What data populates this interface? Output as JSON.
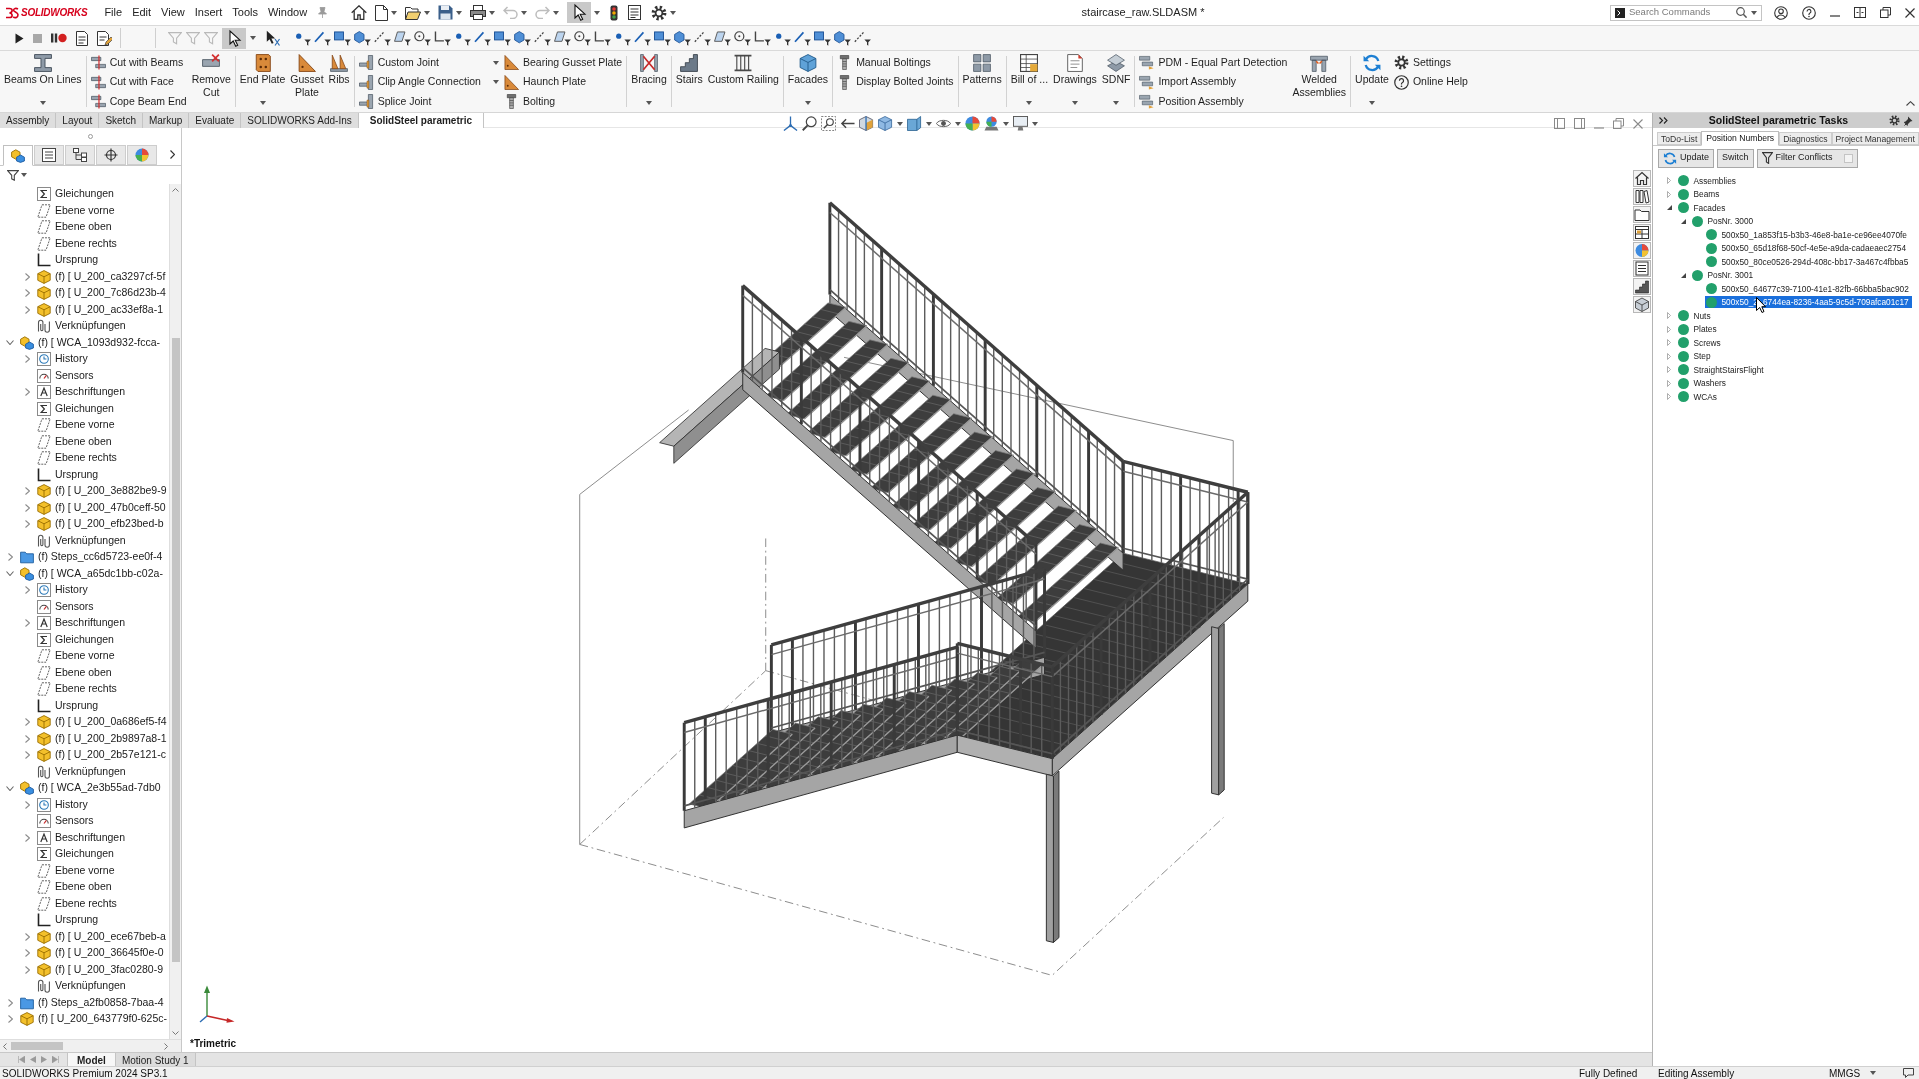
{
  "app_menu": {
    "logo": "SOLIDWORKS",
    "items": [
      "File",
      "Edit",
      "View",
      "Insert",
      "Tools",
      "Window"
    ]
  },
  "quick_access": {
    "undo": {
      "disabled": true
    },
    "redo": {
      "disabled": true
    },
    "select": {
      "on": true
    }
  },
  "window": {
    "title": "staircase_raw.SLDASM *"
  },
  "search": {
    "placeholder": "Search Commands"
  },
  "macro_toolbar": {
    "stop": {
      "disabled": true
    }
  },
  "selection_toolbar": {
    "clear_filters": {
      "disabled": true
    },
    "select": {
      "on": true
    }
  },
  "ribbon": {
    "groups": [
      [
        {
          "kind": "large",
          "label": "Beams On Lines",
          "dropdown": true
        }
      ],
      [
        {
          "kind": "stack",
          "items": [
            {
              "label": "Cut with Beams",
              "dropdown": false
            },
            {
              "label": "Cut with Face",
              "dropdown": false
            },
            {
              "label": "Cope Beam End",
              "dropdown": false
            }
          ]
        },
        {
          "kind": "large",
          "label": "Remove\nCut",
          "dropdown": false
        }
      ],
      [
        {
          "kind": "large",
          "label": "End Plate",
          "dropdown": true
        },
        {
          "kind": "large",
          "label": "Gusset\nPlate",
          "dropdown": false
        },
        {
          "kind": "large",
          "label": "Ribs",
          "dropdown": false
        }
      ],
      [
        {
          "kind": "stack",
          "items": [
            {
              "label": "Custom Joint",
              "dropdown": true
            },
            {
              "label": "Clip Angle Connection",
              "dropdown": true
            },
            {
              "label": "Splice Joint",
              "dropdown": false
            }
          ]
        },
        {
          "kind": "stack",
          "items": [
            {
              "label": "Bearing Gusset Plate",
              "dropdown": false
            },
            {
              "label": "Haunch Plate",
              "dropdown": false
            },
            {
              "label": "Bolting",
              "dropdown": false
            }
          ]
        }
      ],
      [
        {
          "kind": "large",
          "label": "Bracing",
          "dropdown": true
        }
      ],
      [
        {
          "kind": "large",
          "label": "Stairs",
          "dropdown": false
        },
        {
          "kind": "large",
          "label": "Custom Railing",
          "dropdown": false
        }
      ],
      [
        {
          "kind": "large",
          "label": "Facades",
          "dropdown": true
        }
      ],
      [
        {
          "kind": "stack",
          "items": [
            {
              "label": "Manual Boltings",
              "dropdown": false
            },
            {
              "label": "Display Bolted Joints",
              "dropdown": false
            }
          ]
        }
      ],
      [
        {
          "kind": "large",
          "label": "Patterns",
          "dropdown": false
        }
      ],
      [
        {
          "kind": "large",
          "label": "Bill of ...",
          "dropdown": true
        },
        {
          "kind": "large",
          "label": "Drawings",
          "dropdown": true
        },
        {
          "kind": "large",
          "label": "SDNF",
          "dropdown": true
        }
      ],
      [
        {
          "kind": "stack",
          "items": [
            {
              "label": "PDM - Equal Part Detection",
              "dropdown": false
            },
            {
              "label": "Import Assembly",
              "dropdown": false
            },
            {
              "label": "Position Assembly",
              "dropdown": false
            }
          ]
        },
        {
          "kind": "large",
          "label": "Welded\nAssemblies",
          "dropdown": false
        }
      ],
      [
        {
          "kind": "large",
          "label": "Update",
          "dropdown": true
        },
        {
          "kind": "stack",
          "items": [
            {
              "label": "Settings",
              "dropdown": false
            },
            {
              "label": "Online Help",
              "dropdown": false
            }
          ]
        }
      ]
    ]
  },
  "ribbon_tabs": [
    {
      "label": "Assembly",
      "selected": false
    },
    {
      "label": "Layout",
      "selected": false
    },
    {
      "label": "Sketch",
      "selected": false
    },
    {
      "label": "Markup",
      "selected": false
    },
    {
      "label": "Evaluate",
      "selected": false
    },
    {
      "label": "SOLIDWORKS Add-Ins",
      "selected": false
    },
    {
      "label": "SolidSteel parametric",
      "selected": true
    }
  ],
  "feature_panel": {
    "tabs": [
      {
        "selected": true
      },
      {
        "selected": false
      },
      {
        "selected": false
      },
      {
        "selected": false
      },
      {
        "selected": false
      }
    ]
  },
  "feature_tree": {
    "items": [
      {
        "kind": "offscreen",
        "children": [
          {
            "kind": "equations",
            "label": "Gleichungen",
            "selected": false
          },
          {
            "kind": "plane",
            "label": "Ebene vorne",
            "selected": false
          },
          {
            "kind": "plane",
            "label": "Ebene oben",
            "selected": false
          },
          {
            "kind": "plane",
            "label": "Ebene rechts",
            "selected": false
          },
          {
            "kind": "origin",
            "label": "Ursprung",
            "selected": false
          },
          {
            "kind": "part",
            "label": "(f) [ U_200_ca3297cf-5f",
            "expanded": false,
            "selected": false
          },
          {
            "kind": "part",
            "label": "(f) [ U_200_7c86d23b-4",
            "expanded": false,
            "selected": false
          },
          {
            "kind": "part",
            "label": "(f) [ U_200_ac33ef8a-1",
            "expanded": false,
            "selected": false
          },
          {
            "kind": "mates",
            "label": "Verknüpfungen",
            "selected": false
          }
        ]
      },
      {
        "kind": "assembly",
        "label": "(f) [ WCA_1093d932-fcca-",
        "expanded": true,
        "selected": false,
        "children": [
          {
            "kind": "history",
            "label": "History",
            "expanded": false,
            "selected": false
          },
          {
            "kind": "sensors",
            "label": "Sensors",
            "selected": false
          },
          {
            "kind": "annotations",
            "label": "Beschriftungen",
            "expanded": false,
            "selected": false
          },
          {
            "kind": "equations",
            "label": "Gleichungen",
            "selected": false
          },
          {
            "kind": "plane",
            "label": "Ebene vorne",
            "selected": false
          },
          {
            "kind": "plane",
            "label": "Ebene oben",
            "selected": false
          },
          {
            "kind": "plane",
            "label": "Ebene rechts",
            "selected": false
          },
          {
            "kind": "origin",
            "label": "Ursprung",
            "selected": false
          },
          {
            "kind": "part",
            "label": "(f) [ U_200_3e882be9-9",
            "expanded": false,
            "selected": false
          },
          {
            "kind": "part",
            "label": "(f) [ U_200_47b0ceff-50",
            "expanded": false,
            "selected": false
          },
          {
            "kind": "part",
            "label": "(f) [ U_200_efb23bed-b",
            "expanded": false,
            "selected": false
          },
          {
            "kind": "mates",
            "label": "Verknüpfungen",
            "selected": false
          }
        ]
      },
      {
        "kind": "folder",
        "label": "(f) Steps_cc6d5723-ee0f-4",
        "expanded": false,
        "selected": false
      },
      {
        "kind": "assembly",
        "label": "(f) [ WCA_a65dc1bb-c02a-",
        "expanded": true,
        "selected": false,
        "children": [
          {
            "kind": "history",
            "label": "History",
            "expanded": false,
            "selected": false
          },
          {
            "kind": "sensors",
            "label": "Sensors",
            "selected": false
          },
          {
            "kind": "annotations",
            "label": "Beschriftungen",
            "expanded": false,
            "selected": false
          },
          {
            "kind": "equations",
            "label": "Gleichungen",
            "selected": false
          },
          {
            "kind": "plane",
            "label": "Ebene vorne",
            "selected": false
          },
          {
            "kind": "plane",
            "label": "Ebene oben",
            "selected": false
          },
          {
            "kind": "plane",
            "label": "Ebene rechts",
            "selected": false
          },
          {
            "kind": "origin",
            "label": "Ursprung",
            "selected": false
          },
          {
            "kind": "part",
            "label": "(f) [ U_200_0a686ef5-f4",
            "expanded": false,
            "selected": false
          },
          {
            "kind": "part",
            "label": "(f) [ U_200_2b9897a8-1",
            "expanded": false,
            "selected": false
          },
          {
            "kind": "part",
            "label": "(f) [ U_200_2b57e121-c",
            "expanded": false,
            "selected": false
          },
          {
            "kind": "mates",
            "label": "Verknüpfungen",
            "selected": false
          }
        ]
      },
      {
        "kind": "assembly",
        "label": "(f) [ WCA_2e3b55ad-7db0",
        "expanded": true,
        "selected": false,
        "children": [
          {
            "kind": "history",
            "label": "History",
            "expanded": false,
            "selected": false
          },
          {
            "kind": "sensors",
            "label": "Sensors",
            "selected": false
          },
          {
            "kind": "annotations",
            "label": "Beschriftungen",
            "expanded": false,
            "selected": false
          },
          {
            "kind": "equations",
            "label": "Gleichungen",
            "selected": false
          },
          {
            "kind": "plane",
            "label": "Ebene vorne",
            "selected": false
          },
          {
            "kind": "plane",
            "label": "Ebene oben",
            "selected": false
          },
          {
            "kind": "plane",
            "label": "Ebene rechts",
            "selected": false
          },
          {
            "kind": "origin",
            "label": "Ursprung",
            "selected": false
          },
          {
            "kind": "part",
            "label": "(f) [ U_200_ece67beb-a",
            "expanded": false,
            "selected": false
          },
          {
            "kind": "part",
            "label": "(f) [ U_200_36645f0e-0",
            "expanded": false,
            "selected": false
          },
          {
            "kind": "part",
            "label": "(f) [ U_200_3fac0280-9",
            "expanded": false,
            "selected": false
          },
          {
            "kind": "mates",
            "label": "Verknüpfungen",
            "selected": false
          }
        ]
      },
      {
        "kind": "folder",
        "label": "(f) Steps_a2fb0858-7baa-4",
        "expanded": false,
        "selected": false
      },
      {
        "kind": "part",
        "label": "(f) [ U_200_643779f0-625c-",
        "expanded": false,
        "selected": false
      }
    ]
  },
  "viewport": {
    "view_label": "*Trimetric"
  },
  "task_pane": {
    "title": "SolidSteel parametric Tasks",
    "tabs": [
      {
        "label": "ToDo-List",
        "selected": false
      },
      {
        "label": "Position Numbers",
        "selected": true
      },
      {
        "label": "Diagnostics",
        "selected": false
      },
      {
        "label": "Project Management",
        "selected": false
      }
    ],
    "buttons": [
      {
        "kind": "refresh",
        "label": "Update"
      },
      {
        "kind": "plain",
        "label": "Switch"
      },
      {
        "kind": "filter",
        "label": "Filter Conflicts",
        "checked": false
      }
    ],
    "tree": [
      {
        "label": "Assemblies",
        "expanded": false,
        "selected": false
      },
      {
        "label": "Beams",
        "expanded": false,
        "selected": false
      },
      {
        "label": "Facades",
        "expanded": true,
        "selected": false,
        "children": [
          {
            "label": "PosNr. 3000",
            "expanded": true,
            "selected": false,
            "children": [
              {
                "label": "500x50_1a853f15-b3b3-46e8-ba1e-ce96ee4070fe",
                "selected": false
              },
              {
                "label": "500x50_65d18f68-50cf-4e5e-a9da-cadaeaec2754",
                "selected": false
              },
              {
                "label": "500x50_80ce0526-294d-408c-bb17-3a467c4fbba5",
                "selected": false
              }
            ]
          },
          {
            "label": "PosNr. 3001",
            "expanded": true,
            "selected": false,
            "children": [
              {
                "label": "500x50_64677c39-7100-41e1-82fb-66bba5bac902",
                "selected": false
              },
              {
                "label": "500x50_2",
                "label_continued": "6744ea-8236-4aa5-9c5d-709afca01c17",
                "selected": true
              }
            ]
          }
        ]
      },
      {
        "label": "Nuts",
        "expanded": false,
        "selected": false
      },
      {
        "label": "Plates",
        "expanded": false,
        "selected": false
      },
      {
        "label": "Screws",
        "expanded": false,
        "selected": false
      },
      {
        "label": "Step",
        "expanded": false,
        "selected": false
      },
      {
        "label": "StraightStairsFlight",
        "expanded": false,
        "selected": false
      },
      {
        "label": "Washers",
        "expanded": false,
        "selected": false
      },
      {
        "label": "WCAs",
        "expanded": false,
        "selected": false
      }
    ]
  },
  "bottom_tabs": [
    {
      "label": "Model",
      "selected": true
    },
    {
      "label": "Motion Study 1",
      "selected": false
    }
  ],
  "status_bar": {
    "product": "SOLIDWORKS Premium 2024 SP3.1",
    "fields": [
      "Fully Defined",
      "Editing Assembly"
    ],
    "units": "MMGS"
  }
}
